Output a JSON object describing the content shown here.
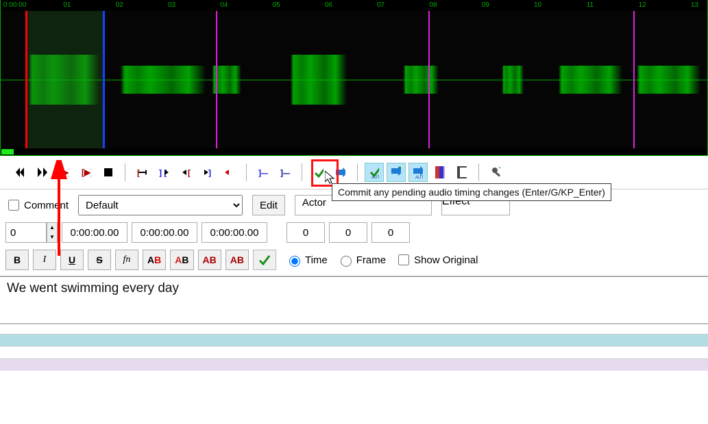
{
  "timeline": {
    "ticks": [
      "0:00:00",
      "01",
      "02",
      "03",
      "04",
      "05",
      "06",
      "07",
      "08",
      "09",
      "10",
      "11",
      "12",
      "13"
    ],
    "tick_spacing_percent": 7.4,
    "selection_start_pct": 3.5,
    "selection_end_pct": 14.5,
    "cue_red_pct": 3.5,
    "cue_blue_pct": 14.5,
    "cue_magenta": [
      30.5,
      60.5,
      89.5
    ]
  },
  "tooltip": "Commit any pending audio timing changes (Enter/G/KP_Enter)",
  "fields": {
    "comment_label": "Comment",
    "style_value": "Default",
    "edit_label": "Edit",
    "actor_label": "Actor",
    "effect_label": "Effect",
    "layer": "0",
    "start_time": "0:00:00.00",
    "end_time": "0:00:00.00",
    "duration": "0:00:00.00",
    "margin_l": "0",
    "margin_r": "0",
    "margin_v": "0"
  },
  "fmt": {
    "bold": "B",
    "italic": "I",
    "underline": "U",
    "strike": "S",
    "fn": "fn",
    "ab1": "AB",
    "ab2": "AB",
    "ab3": "AB",
    "ab4": "AB",
    "time_label": "Time",
    "frame_label": "Frame",
    "show_original_label": "Show Original"
  },
  "subtitle_text": "We went swimming every day"
}
